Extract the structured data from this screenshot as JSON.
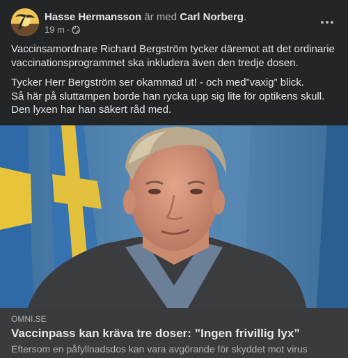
{
  "post": {
    "author": "Hasse Hermansson",
    "with_text": "är med",
    "tagged": "Carl Norberg",
    "tagged_suffix": ".",
    "time": "19 m",
    "dot": "·",
    "privacy_icon": "globe-icon",
    "more_icon": "more-options-icon",
    "paragraphs": [
      "Vaccinsamordnare Richard Bergström tycker däremot att det ordinarie vaccinationsprogrammet ska inkludera även den tredje dosen.",
      "Tycker Herr Bergström ser okammad ut! - och med”vaxig” blick.",
      "Så här på sluttampen borde han rycka upp sig lite för optikens skull.",
      "Den lyxen har han säkert råd med."
    ]
  },
  "link": {
    "domain": "OMNI.SE",
    "title": "Vaccinpass kan kräva tre doser: ”Ingen frivillig lyx”",
    "description": "Eftersom en påfyllnadsdos kan vara avgörande för skyddet mot virus"
  },
  "colors": {
    "background": "#242526",
    "card": "#3a3b3c",
    "text_primary": "#e4e6eb",
    "text_secondary": "#b0b3b8"
  }
}
